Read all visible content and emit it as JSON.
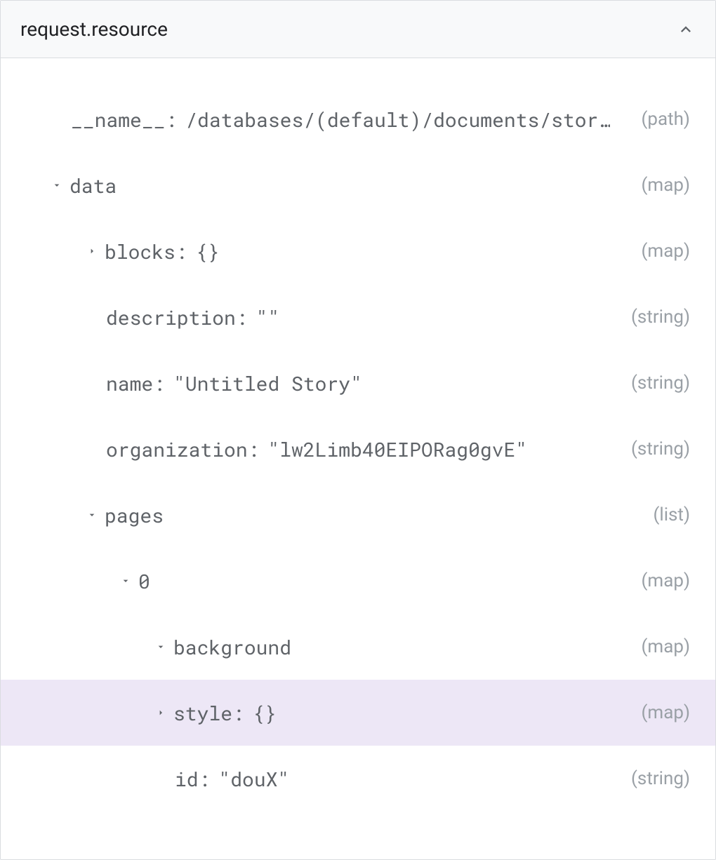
{
  "header": {
    "title": "request.resource"
  },
  "rows": {
    "name": {
      "key": "__name__",
      "value": "/databases/(default)/documents/stor…",
      "type": "(path)"
    },
    "data": {
      "key": "data",
      "type": "(map)"
    },
    "blocks": {
      "key": "blocks",
      "value": "{}",
      "type": "(map)"
    },
    "description": {
      "key": "description",
      "value": "\"\"",
      "type": "(string)"
    },
    "dataname": {
      "key": "name",
      "value": "\"Untitled Story\"",
      "type": "(string)"
    },
    "organization": {
      "key": "organization",
      "value": "\"lw2Limb40EIPORag0gvE\"",
      "type": "(string)"
    },
    "pages": {
      "key": "pages",
      "type": "(list)"
    },
    "page0": {
      "key": "0",
      "type": "(map)"
    },
    "background": {
      "key": "background",
      "type": "(map)"
    },
    "style": {
      "key": "style",
      "value": "{}",
      "type": "(map)"
    },
    "id": {
      "key": "id",
      "value": "\"douX\"",
      "type": "(string)"
    }
  }
}
